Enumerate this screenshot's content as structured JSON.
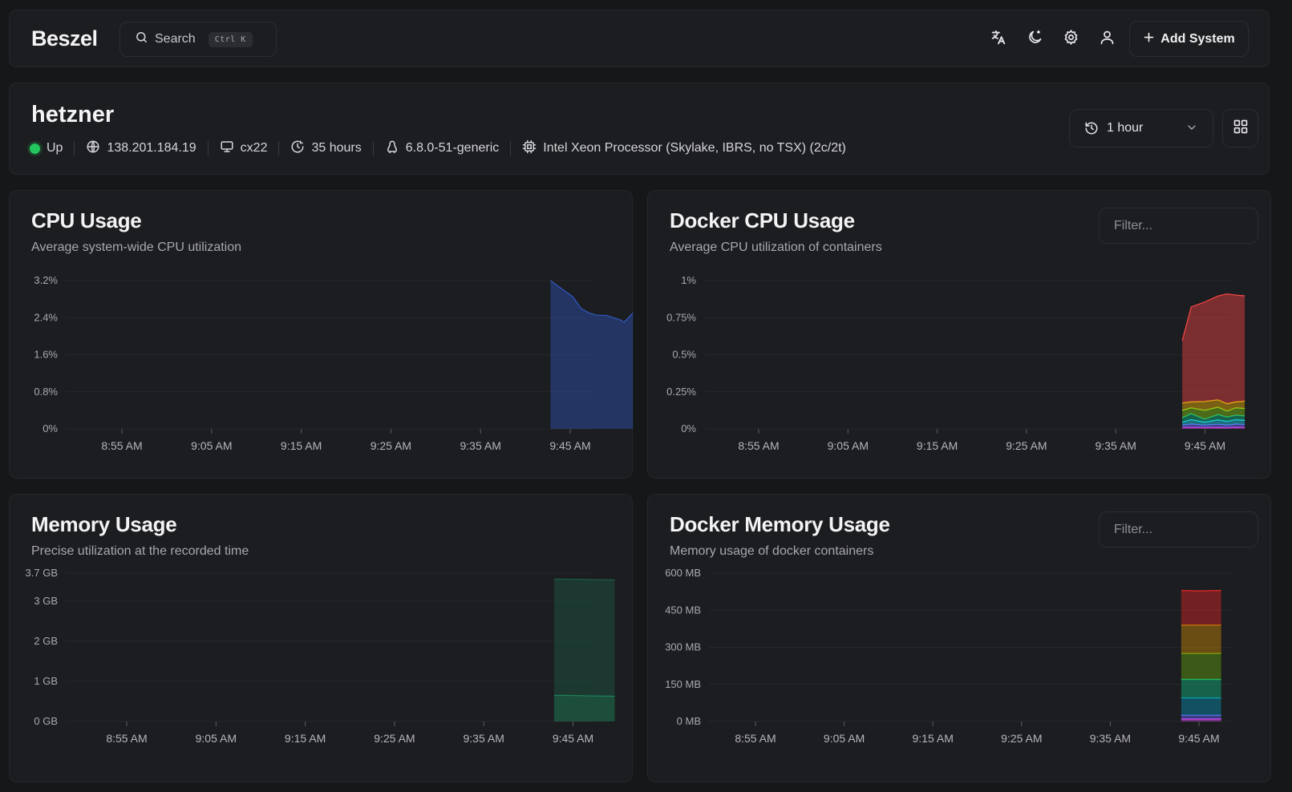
{
  "header": {
    "logo": "Beszel",
    "search_label": "Search",
    "search_kbd": "Ctrl  K",
    "add_system": "Add System",
    "icons": [
      "translate-icon",
      "moon-icon",
      "gear-icon",
      "user-icon"
    ]
  },
  "system": {
    "name": "hetzner",
    "status": "Up",
    "status_color": "#22c55e",
    "ip": "138.201.184.19",
    "type": "cx22",
    "uptime": "35 hours",
    "kernel": "6.8.0-51-generic",
    "cpu": "Intel Xeon Processor (Skylake, IBRS, no TSX) (2c/2t)",
    "time_range": "1 hour"
  },
  "charts": {
    "cpu": {
      "title": "CPU Usage",
      "subtitle": "Average system-wide CPU utilization"
    },
    "docker_cpu": {
      "title": "Docker CPU Usage",
      "subtitle": "Average CPU utilization of containers",
      "filter_placeholder": "Filter..."
    },
    "memory": {
      "title": "Memory Usage",
      "subtitle": "Precise utilization at the recorded time"
    },
    "docker_memory": {
      "title": "Docker Memory Usage",
      "subtitle": "Memory usage of docker containers",
      "filter_placeholder": "Filter..."
    }
  },
  "chart_data": [
    {
      "id": "cpu",
      "type": "area",
      "ylim": [
        0,
        3.2
      ],
      "y_ticks": [
        "0%",
        "0.8%",
        "1.6%",
        "2.4%",
        "3.2%"
      ],
      "x_ticks": [
        "8:55 AM",
        "9:05 AM",
        "9:15 AM",
        "9:25 AM",
        "9:35 AM",
        "9:45 AM"
      ],
      "x_minutes": [
        -2.2,
        0.3,
        1.2,
        2.1,
        3.0,
        4.0,
        4.8,
        5.6,
        6.0,
        6.5,
        7.0
      ],
      "series": [
        {
          "color": "#2f55b8",
          "values": [
            3.2,
            2.85,
            2.6,
            2.5,
            2.45,
            2.45,
            2.4,
            2.35,
            2.3,
            2.4,
            2.5
          ]
        }
      ],
      "grid": true
    },
    {
      "id": "docker_cpu",
      "type": "area",
      "ylim": [
        0,
        1
      ],
      "y_ticks": [
        "0%",
        "0.25%",
        "0.5%",
        "0.75%",
        "1%"
      ],
      "x_ticks": [
        "8:55 AM",
        "9:05 AM",
        "9:15 AM",
        "9:25 AM",
        "9:35 AM",
        "9:45 AM"
      ],
      "x_minutes": [
        -2.5,
        -1.5,
        0,
        1.5,
        2.5,
        3.5,
        4.5
      ],
      "stacked": true,
      "series": [
        {
          "color": "#d946ef",
          "values": [
            0.01,
            0.012,
            0.01,
            0.011,
            0.01,
            0.012,
            0.011
          ]
        },
        {
          "color": "#6366f1",
          "values": [
            0.015,
            0.02,
            0.015,
            0.02,
            0.015,
            0.02,
            0.018
          ]
        },
        {
          "color": "#22d3ee",
          "values": [
            0.02,
            0.03,
            0.02,
            0.03,
            0.025,
            0.03,
            0.028
          ]
        },
        {
          "color": "#10b981",
          "values": [
            0.03,
            0.04,
            0.02,
            0.035,
            0.03,
            0.03,
            0.03
          ]
        },
        {
          "color": "#84cc16",
          "values": [
            0.05,
            0.04,
            0.06,
            0.05,
            0.04,
            0.05,
            0.05
          ]
        },
        {
          "color": "#eab308",
          "values": [
            0.05,
            0.04,
            0.06,
            0.05,
            0.05,
            0.04,
            0.05
          ]
        },
        {
          "color": "#ef4444",
          "values": [
            0.42,
            0.64,
            0.67,
            0.7,
            0.74,
            0.72,
            0.71
          ]
        }
      ],
      "grid": true
    },
    {
      "id": "memory",
      "type": "area",
      "ylim": [
        0,
        3.7
      ],
      "y_ticks": [
        "0 GB",
        "1 GB",
        "2 GB",
        "3 GB",
        "3.7 GB"
      ],
      "y_tick_values": [
        0,
        1,
        2,
        3,
        3.7
      ],
      "x_ticks": [
        "8:55 AM",
        "9:05 AM",
        "9:15 AM",
        "9:25 AM",
        "9:35 AM",
        "9:45 AM"
      ],
      "x_minutes": [
        -1.9,
        0,
        2,
        4.9
      ],
      "stacked": true,
      "series": [
        {
          "color": "#1f8a5e",
          "values": [
            0.65,
            0.65,
            0.64,
            0.63
          ]
        },
        {
          "color": "#1d5c44",
          "values": [
            2.9,
            2.9,
            2.9,
            2.9
          ]
        }
      ],
      "grid": true
    },
    {
      "id": "docker_memory",
      "type": "area",
      "ylim": [
        0,
        600
      ],
      "y_ticks": [
        "0 MB",
        "150 MB",
        "300 MB",
        "450 MB",
        "600 MB"
      ],
      "x_ticks": [
        "8:55 AM",
        "9:05 AM",
        "9:15 AM",
        "9:25 AM",
        "9:35 AM",
        "9:45 AM"
      ],
      "x_minutes": [
        -2.0,
        0,
        2.5
      ],
      "stacked": true,
      "series": [
        {
          "color": "#d946ef",
          "values": [
            10,
            10,
            10
          ]
        },
        {
          "color": "#6366f1",
          "values": [
            15,
            15,
            15
          ]
        },
        {
          "color": "#0891b2",
          "values": [
            70,
            70,
            70
          ]
        },
        {
          "color": "#10b981",
          "values": [
            75,
            75,
            75
          ]
        },
        {
          "color": "#65a30d",
          "values": [
            105,
            105,
            105
          ]
        },
        {
          "color": "#ca8a04",
          "values": [
            115,
            115,
            115
          ]
        },
        {
          "color": "#dc2626",
          "values": [
            140,
            138,
            140
          ]
        }
      ],
      "grid": true
    }
  ]
}
